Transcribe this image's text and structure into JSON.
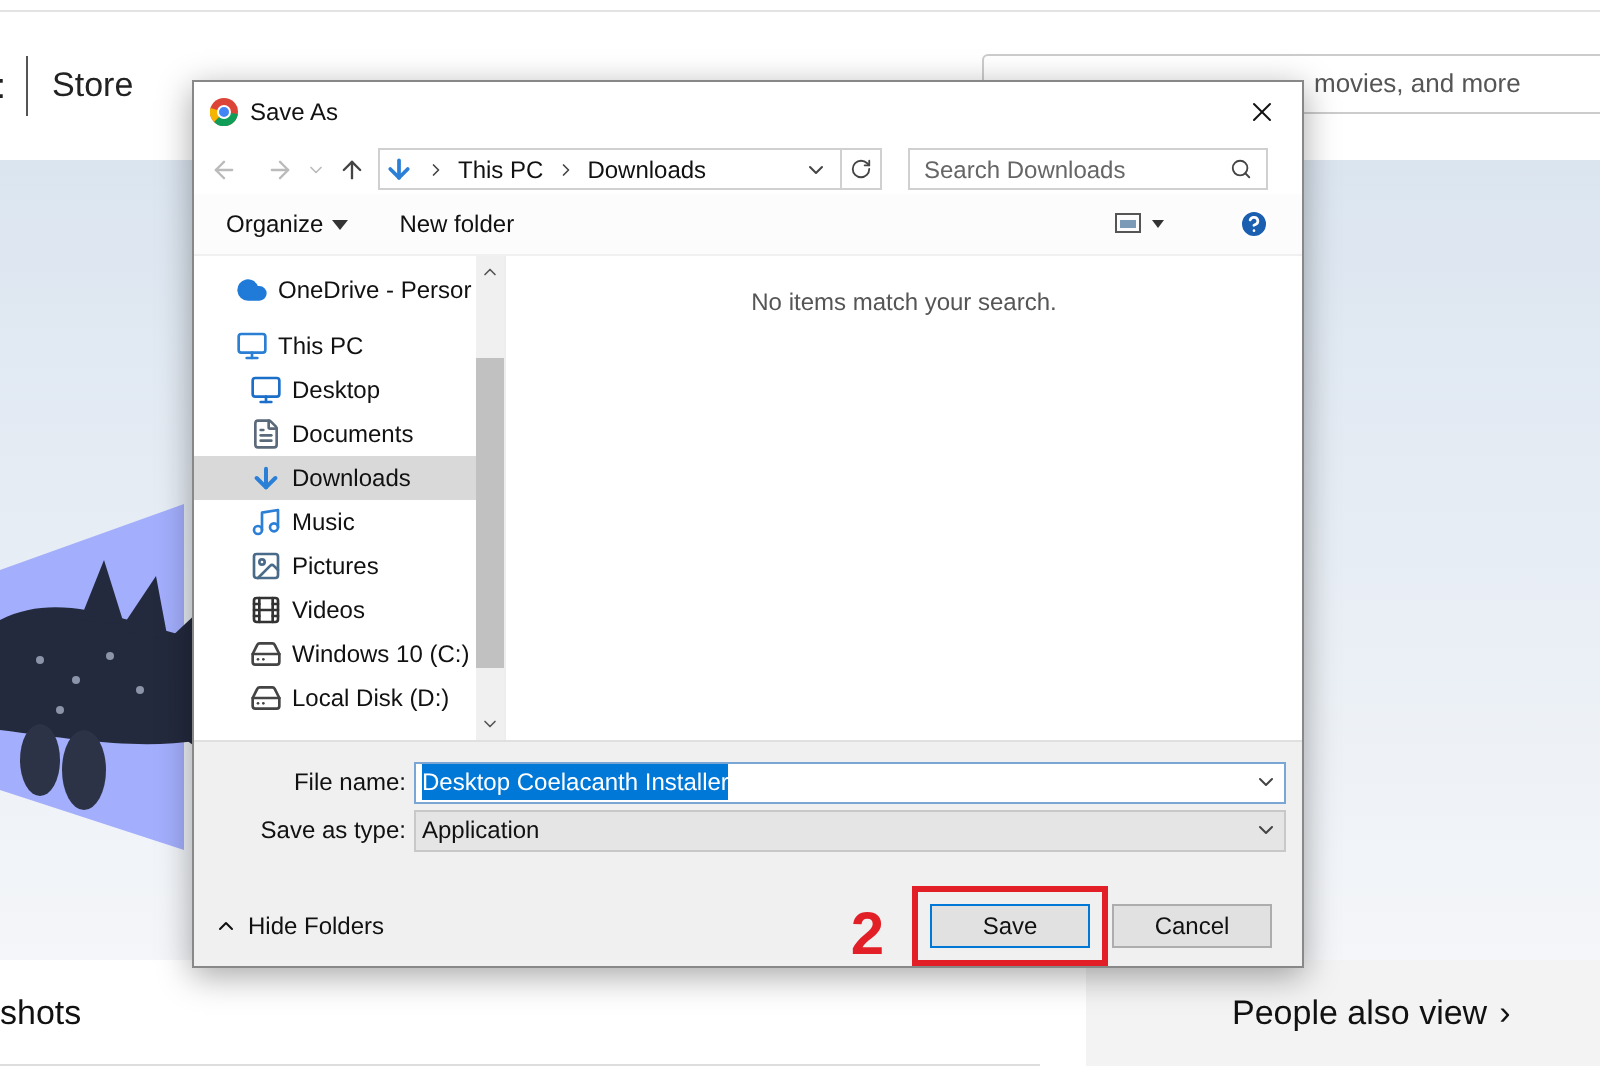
{
  "store": {
    "logo_partial": ":",
    "title": "Store",
    "search": {
      "placeholder": "movies, and more"
    },
    "section_heading": "shots",
    "side_heading": "People also view",
    "side_chevron": "›"
  },
  "dialog": {
    "title": "Save As",
    "breadcrumb": [
      "This PC",
      "Downloads"
    ],
    "search": {
      "placeholder": "Search Downloads"
    },
    "toolbar": {
      "organize": "Organize",
      "new_folder": "New folder"
    },
    "nav_items": [
      {
        "kind": "cloud",
        "label": "OneDrive - Persor",
        "selected": false
      },
      {
        "kind": "pc",
        "label": "This PC",
        "selected": false,
        "children": [
          {
            "kind": "desktop",
            "label": "Desktop",
            "selected": false
          },
          {
            "kind": "documents",
            "label": "Documents",
            "selected": false
          },
          {
            "kind": "downloads",
            "label": "Downloads",
            "selected": true
          },
          {
            "kind": "music",
            "label": "Music",
            "selected": false
          },
          {
            "kind": "pictures",
            "label": "Pictures",
            "selected": false
          },
          {
            "kind": "videos",
            "label": "Videos",
            "selected": false
          },
          {
            "kind": "drive",
            "label": "Windows 10 (C:)",
            "selected": false
          },
          {
            "kind": "drive",
            "label": "Local Disk (D:)",
            "selected": false
          }
        ]
      }
    ],
    "empty_message": "No items match your search.",
    "file_name": {
      "label": "File name:",
      "value": "Desktop Coelacanth Installer"
    },
    "save_type": {
      "label": "Save as type:",
      "value": "Application"
    },
    "hide_folders": "Hide Folders",
    "buttons": [
      {
        "label": "Save",
        "highlighted": true
      },
      {
        "label": "Cancel",
        "highlighted": false
      }
    ],
    "step_marker": "2"
  }
}
